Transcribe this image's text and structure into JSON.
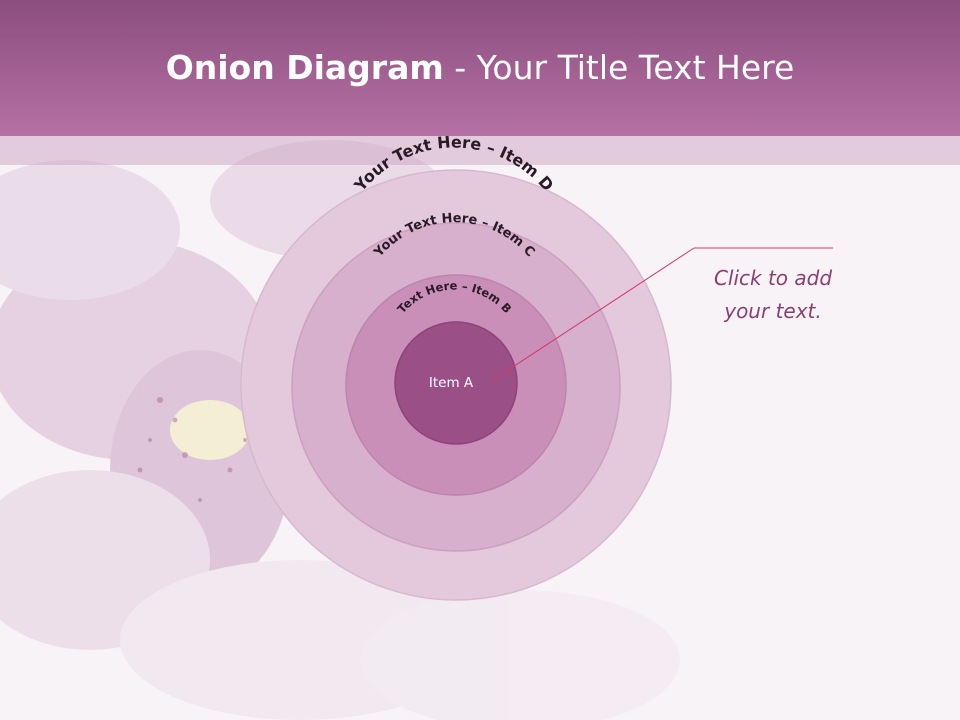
{
  "title": {
    "bold": "Onion Diagram",
    "rest": " - Your Title Text Here"
  },
  "layers": [
    {
      "label": "Your Text Here – Item D",
      "color": "#e4c8dc"
    },
    {
      "label": "Your Text Here – Item C",
      "color": "#d7b0cd"
    },
    {
      "label": "Text Here – Item B",
      "color": "#c98fb9"
    },
    {
      "label": "Item A",
      "color": "#9b4f87"
    }
  ],
  "callout": {
    "line1": "Click  to add",
    "line2": "your text."
  },
  "colors": {
    "title_bar": "#a35f94",
    "accent_line": "#d7376a",
    "callout_text": "#8b4070"
  }
}
